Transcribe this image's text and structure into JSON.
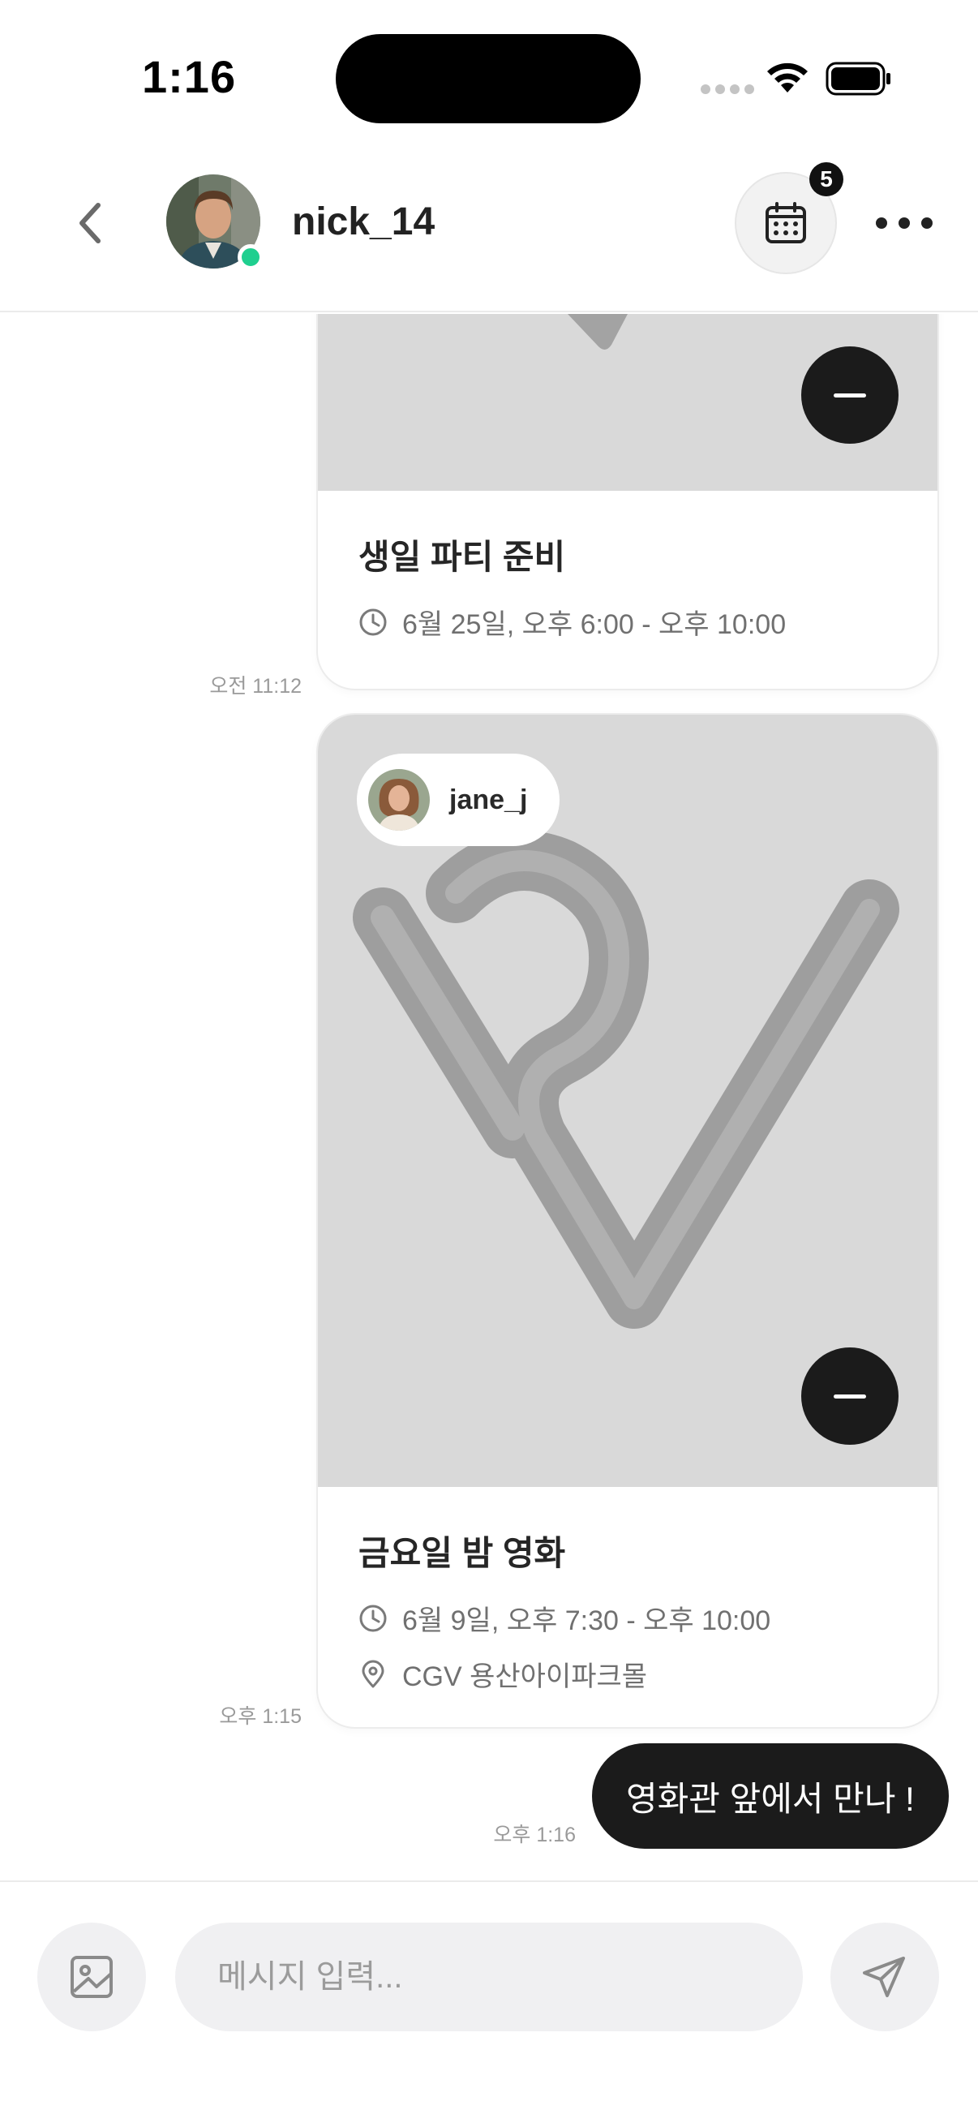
{
  "status_bar": {
    "time": "1:16"
  },
  "header": {
    "username": "nick_14",
    "calendar_badge": "5"
  },
  "messages": [
    {
      "type": "event-card",
      "title": "생일 파티 준비",
      "datetime": "6월 25일, 오후 6:00 - 오후 10:00",
      "time": "오전 11:12"
    },
    {
      "type": "event-card",
      "author": "jane_j",
      "title": "금요일 밤 영화",
      "datetime": "6월 9일, 오후 7:30 - 오후 10:00",
      "location": "CGV 용산아이파크몰",
      "time": "오후 1:15"
    },
    {
      "type": "text",
      "text": "영화관 앞에서 만나 !",
      "time": "오후 1:16"
    }
  ],
  "composer": {
    "placeholder": "메시지 입력..."
  },
  "colors": {
    "online": "#1fcf8f",
    "dark": "#1b1b1b",
    "image_bg": "#d9d9d9"
  }
}
